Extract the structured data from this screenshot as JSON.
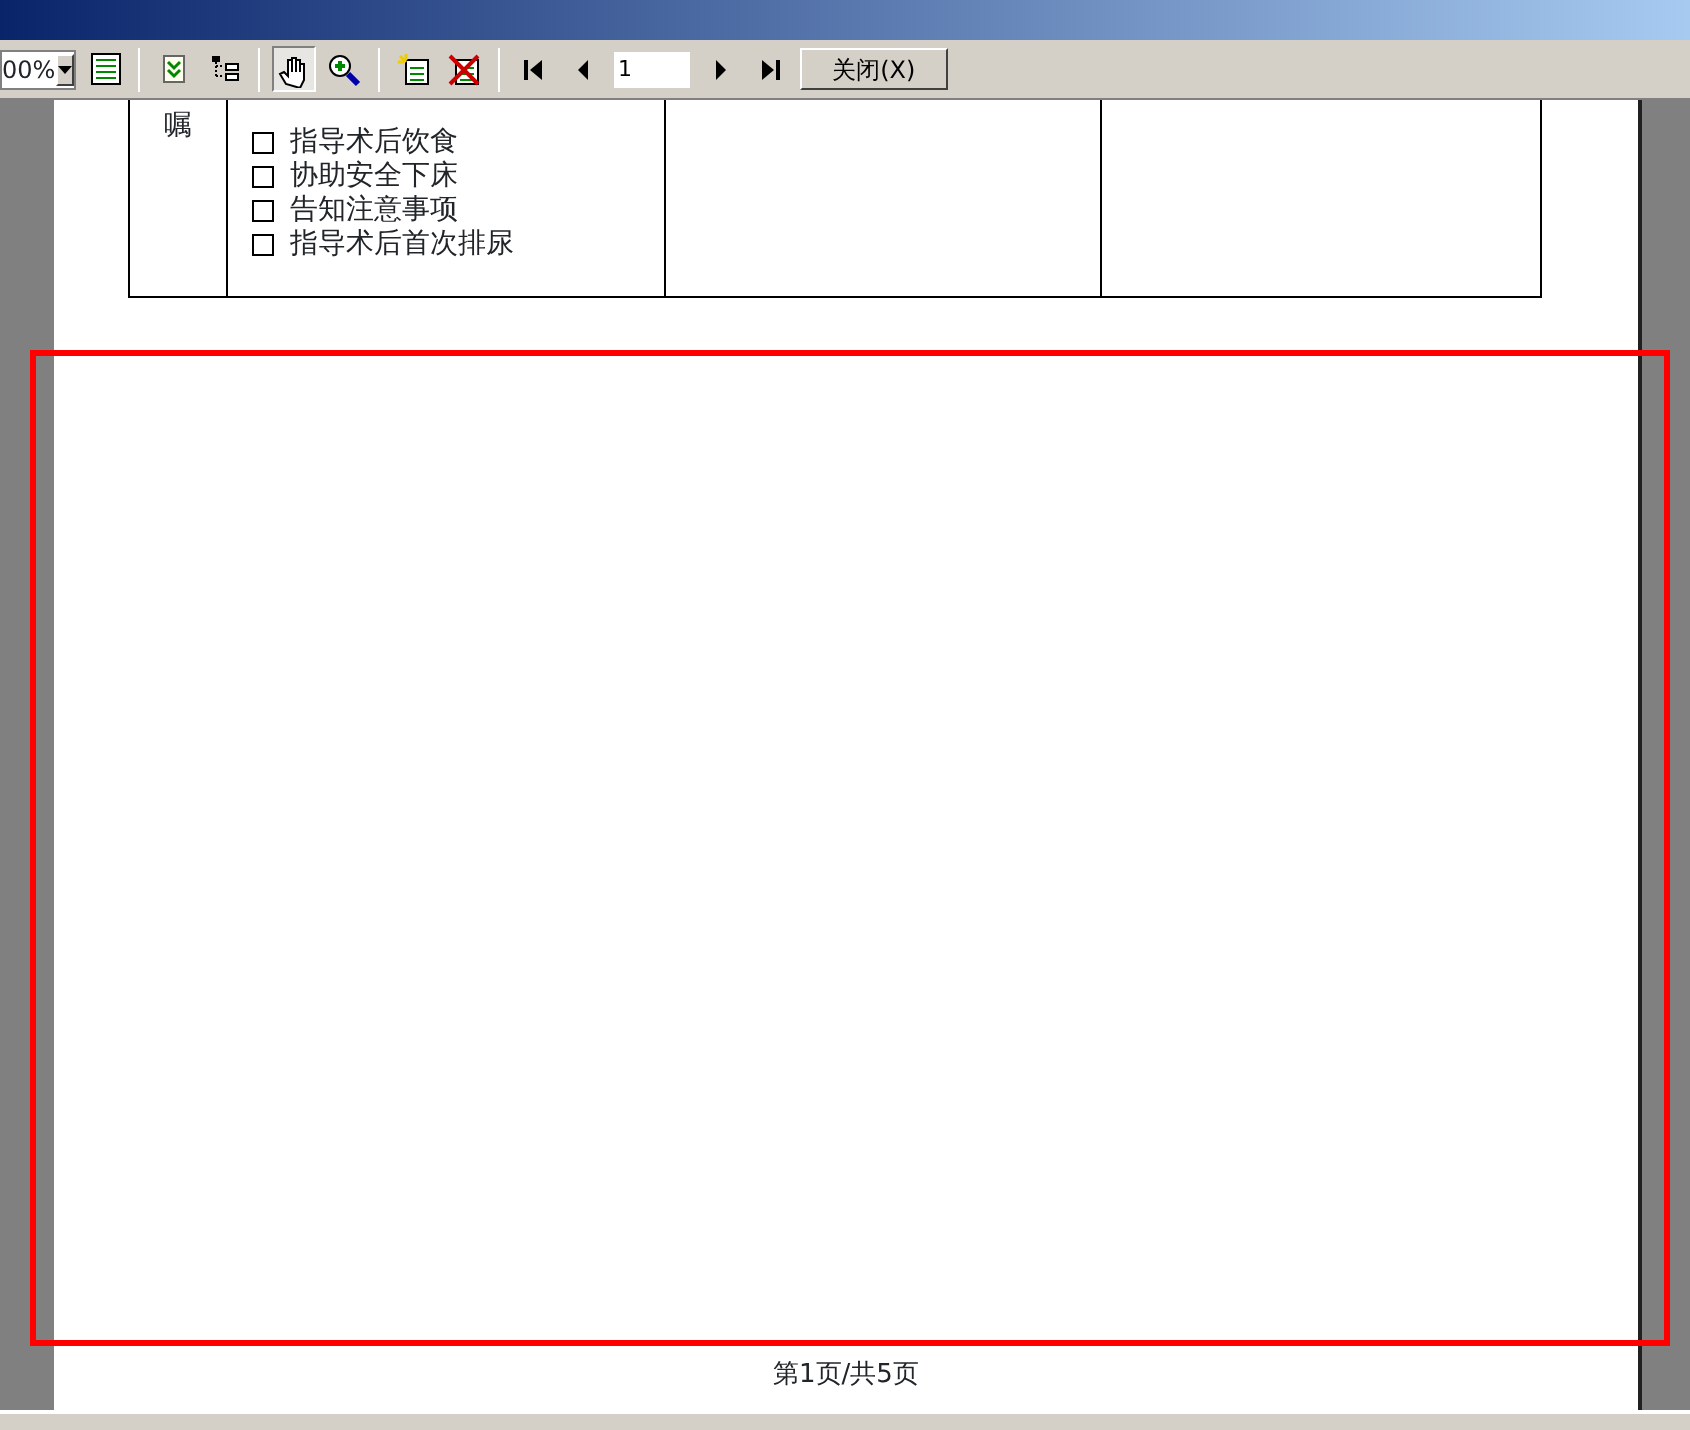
{
  "toolbar": {
    "zoom": "00%",
    "tools": [
      {
        "kind": "layout",
        "pressed": false
      },
      {
        "kind": "expand",
        "pressed": false
      },
      {
        "kind": "tree",
        "pressed": false
      },
      {
        "kind": "hand",
        "pressed": true
      },
      {
        "kind": "zoom",
        "pressed": false
      },
      {
        "kind": "new",
        "pressed": false
      },
      {
        "kind": "delete",
        "pressed": false
      }
    ],
    "page_number": "1",
    "close_button": "关闭(X)"
  },
  "table": {
    "row_label": "嘱",
    "column_2": {
      "items": [
        {
          "text": "指导术后饮食",
          "checked": false
        },
        {
          "text": "协助安全下床",
          "checked": false
        },
        {
          "text": "告知注意事项",
          "checked": false
        },
        {
          "text": "指导术后首次排尿",
          "checked": false
        }
      ]
    }
  },
  "footer": "第1页/共5页"
}
